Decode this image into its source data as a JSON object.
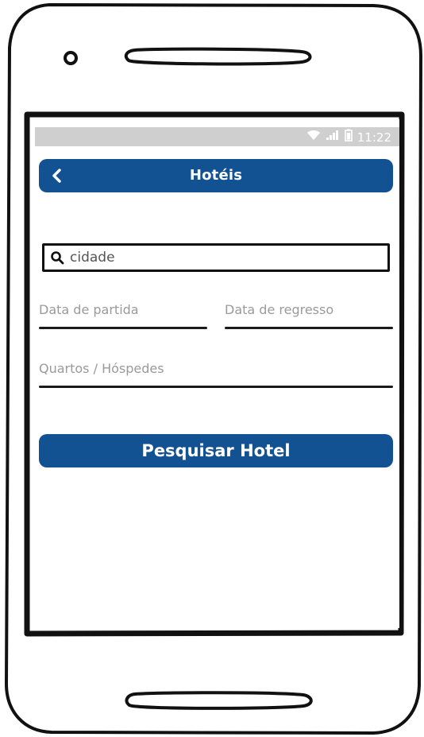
{
  "status_bar": {
    "wifi_icon": "wifi-icon",
    "signal_icon": "signal-icon",
    "battery_icon": "battery-icon",
    "time": "11:22"
  },
  "header": {
    "back_icon": "chevron-left-icon",
    "title": "Hotéis"
  },
  "form": {
    "city_placeholder": "cidade",
    "search_icon": "search-icon",
    "departure_label": "Data de partida",
    "return_label": "Data de regresso",
    "rooms_guests_label": "Quartos / Hóspedes",
    "submit_label": "Pesquisar Hotel"
  },
  "colors": {
    "primary": "#135292",
    "status_bar": "#cfcfcf",
    "frame": "#111111",
    "label_gray": "#9a9a9a"
  }
}
